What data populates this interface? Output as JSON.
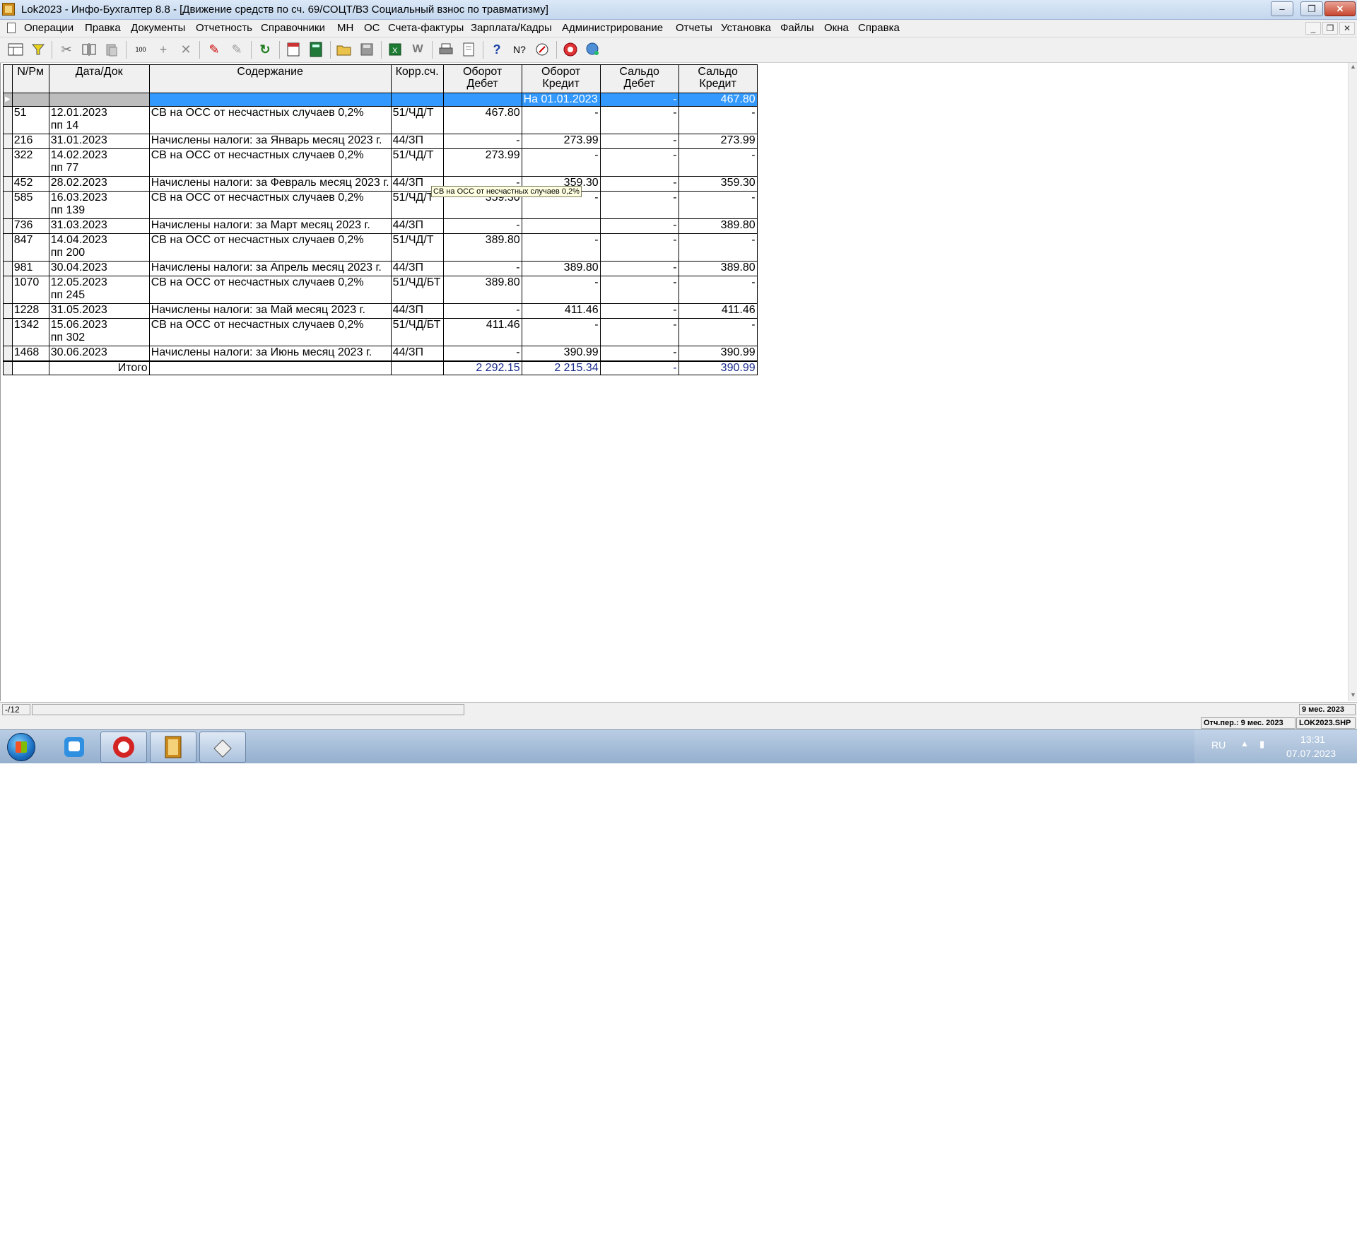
{
  "window": {
    "title": "Lok2023 - Инфо-Бухгалтер 8.8 - [Движение средств по сч. 69/СОЦТ/ВЗ Социальный взнос по травматизму]"
  },
  "menu": [
    "Операции",
    "Правка",
    "Документы",
    "Отчетность",
    "Справочники",
    "МН",
    "ОС",
    "Счета-фактуры",
    "Зарплата/Кадры",
    "Администрирование",
    "Отчеты",
    "Установка",
    "Файлы",
    "Окна",
    "Справка"
  ],
  "toolbar_icons": [
    "layout-icon",
    "filter-icon",
    "cut-icon",
    "split-icon",
    "paste-icon",
    "counter-icon",
    "add-icon",
    "delete-icon",
    "mark-icon",
    "unmark-icon",
    "refresh-icon",
    "calendar-icon",
    "calculator-icon",
    "open-folder-icon",
    "save-icon",
    "excel-icon",
    "word-icon",
    "print-icon",
    "preview-icon",
    "help-icon",
    "context-help-icon",
    "compass-icon",
    "lifebuoy-icon",
    "web-icon"
  ],
  "table": {
    "headers": {
      "n": "N/Рм",
      "date": "Дата/Док",
      "content": "Содержание",
      "corr": "Корр.сч.",
      "od1": "Оборот",
      "od2": "Дебет",
      "ok1": "Оборот",
      "ok2": "Кредит",
      "sd1": "Сальдо",
      "sd2": "Дебет",
      "sk1": "Сальдо",
      "sk2": "Кредит"
    },
    "opening": {
      "label": "На 01.01.2023",
      "sd": "-",
      "sk": "467.80"
    },
    "rows": [
      {
        "n": "51",
        "date": "12.01.2023",
        "doc": "пп 14",
        "content": "СВ на ОСС от несчастных случаев 0,2%",
        "corr": "51/ЧД/Т",
        "od": "467.80",
        "ok": "-",
        "sd": "-",
        "sk": "-"
      },
      {
        "n": "216",
        "date": "31.01.2023",
        "doc": "",
        "content": "Начислены налоги:  за Январь месяц 2023 г.",
        "corr": "44/ЗП",
        "od": "-",
        "ok": "273.99",
        "sd": "-",
        "sk": "273.99"
      },
      {
        "n": "322",
        "date": "14.02.2023",
        "doc": "пп 77",
        "content": "СВ на ОСС от несчастных случаев 0,2%",
        "corr": "51/ЧД/Т",
        "od": "273.99",
        "ok": "-",
        "sd": "-",
        "sk": "-"
      },
      {
        "n": "452",
        "date": "28.02.2023",
        "doc": "",
        "content": "Начислены налоги:  за Февраль месяц 2023 г.",
        "corr": "44/ЗП",
        "od": "-",
        "ok": "359.30",
        "sd": "-",
        "sk": "359.30"
      },
      {
        "n": "585",
        "date": "16.03.2023",
        "doc": "пп 139",
        "content": "СВ на ОСС от несчастных случаев 0,2%",
        "corr": "51/ЧД/Т",
        "od": "359.30",
        "ok": "-",
        "sd": "-",
        "sk": "-"
      },
      {
        "n": "736",
        "date": "31.03.2023",
        "doc": "",
        "content": "Начислены налоги:  за Март месяц 2023 г.",
        "corr": "44/ЗП",
        "od": "-",
        "ok": "",
        "sd": "-",
        "sk": "389.80"
      },
      {
        "n": "847",
        "date": "14.04.2023",
        "doc": "пп 200",
        "content": "СВ на ОСС от несчастных случаев 0,2%",
        "corr": "51/ЧД/Т",
        "od": "389.80",
        "ok": "-",
        "sd": "-",
        "sk": "-"
      },
      {
        "n": "981",
        "date": "30.04.2023",
        "doc": "",
        "content": "Начислены налоги:  за Апрель месяц 2023 г.",
        "corr": "44/ЗП",
        "od": "-",
        "ok": "389.80",
        "sd": "-",
        "sk": "389.80"
      },
      {
        "n": "1070",
        "date": "12.05.2023",
        "doc": "пп 245",
        "content": "СВ на ОСС от несчастных случаев 0,2%",
        "corr": "51/ЧД/БТ",
        "od": "389.80",
        "ok": "-",
        "sd": "-",
        "sk": "-"
      },
      {
        "n": "1228",
        "date": "31.05.2023",
        "doc": "",
        "content": "Начислены налоги:  за Май месяц 2023 г.",
        "corr": "44/ЗП",
        "od": "-",
        "ok": "411.46",
        "sd": "-",
        "sk": "411.46"
      },
      {
        "n": "1342",
        "date": "15.06.2023",
        "doc": "пп 302",
        "content": "СВ на ОСС от несчастных случаев 0,2%",
        "corr": "51/ЧД/БТ",
        "od": "411.46",
        "ok": "-",
        "sd": "-",
        "sk": "-"
      },
      {
        "n": "1468",
        "date": "30.06.2023",
        "doc": "",
        "content": "Начислены налоги:  за Июнь месяц 2023 г.",
        "corr": "44/ЗП",
        "od": "-",
        "ok": "390.99",
        "sd": "-",
        "sk": "390.99"
      }
    ],
    "total": {
      "label": "Итого",
      "od": "2 292.15",
      "ok": "2 215.34",
      "sd": "-",
      "sk": "390.99"
    },
    "tooltip": "СВ на ОСС от несчастных случаев 0,2%"
  },
  "status": {
    "record": "-/12",
    "period": "9 мес. 2023",
    "report_period": "Отч.пер.: 9 мес. 2023",
    "file": "LOK2023.SHP"
  },
  "taskbar": {
    "lang": "RU",
    "time": "13:31",
    "date": "07.07.2023"
  }
}
